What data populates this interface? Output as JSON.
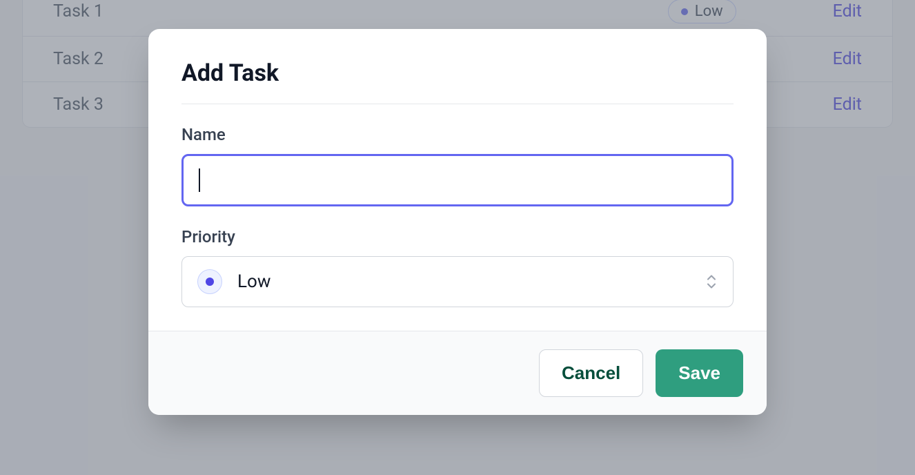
{
  "tasks": [
    {
      "name": "Task 1",
      "priority": "Low",
      "action": "Edit",
      "show_badge": true
    },
    {
      "name": "Task 2",
      "priority": "",
      "action": "Edit",
      "show_badge": false
    },
    {
      "name": "Task 3",
      "priority": "",
      "action": "Edit",
      "show_badge": false
    }
  ],
  "modal": {
    "title": "Add Task",
    "name_label": "Name",
    "name_value": "",
    "priority_label": "Priority",
    "priority_selected": "Low",
    "cancel_label": "Cancel",
    "save_label": "Save"
  }
}
